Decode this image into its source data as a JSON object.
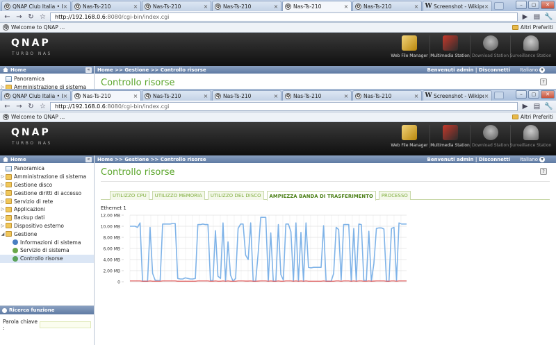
{
  "browser": {
    "tabs": [
      {
        "title": "QNAP Club Italia • Leg...",
        "favicon": "Q"
      },
      {
        "title": "Nas-Ts-210",
        "favicon": "Q"
      },
      {
        "title": "Nas-Ts-210",
        "favicon": "Q"
      },
      {
        "title": "Nas-Ts-210",
        "favicon": "Q"
      },
      {
        "title": "Nas-Ts-210",
        "favicon": "Q"
      },
      {
        "title": "Nas-Ts-210",
        "favicon": "Q"
      },
      {
        "title": "Screenshot - Wikipedia",
        "favicon": "W"
      }
    ],
    "back_active_tab": 4,
    "front_active_tab": 1,
    "url_host": "http://192.168.0.6",
    "url_path": ":8080/cgi-bin/index.cgi",
    "bookmark": "Welcome to QNAP ...",
    "other_bookmarks": "Altri Preferiti"
  },
  "qnap": {
    "logo": "QNAP",
    "subtitle": "TURBO NAS",
    "apps": [
      {
        "label": "Web File Manager",
        "icon": "web-file-manager-icon",
        "dim": false
      },
      {
        "label": "Multimedia Station",
        "icon": "multimedia-station-icon",
        "dim": false
      },
      {
        "label": "Download Station",
        "icon": "download-station-icon",
        "dim": true
      },
      {
        "label": "Surveillance Station",
        "icon": "surveillance-station-icon",
        "dim": true
      }
    ],
    "home_label": "Home",
    "breadcrumb": "Home >> Gestione >> Controllo risorse",
    "welcome": "Benvenuti admin | Disconnetti",
    "language": "Italiano",
    "page_title": "Controllo risorse"
  },
  "tree": [
    {
      "label": "Panoramica",
      "type": "page",
      "arrow": "",
      "level": 0
    },
    {
      "label": "Amministrazione di sistema",
      "type": "folder",
      "arrow": "▷",
      "level": 0
    },
    {
      "label": "Gestione disco",
      "type": "folder",
      "arrow": "▷",
      "level": 0
    },
    {
      "label": "Gestione diritti di accesso",
      "type": "folder",
      "arrow": "▷",
      "level": 0
    },
    {
      "label": "Servizio di rete",
      "type": "folder",
      "arrow": "▷",
      "level": 0
    },
    {
      "label": "Applicazioni",
      "type": "folder",
      "arrow": "▷",
      "level": 0
    },
    {
      "label": "Backup dati",
      "type": "folder",
      "arrow": "▷",
      "level": 0
    },
    {
      "label": "Dispositivo esterno",
      "type": "folder",
      "arrow": "▷",
      "level": 0
    },
    {
      "label": "Gestione",
      "type": "folder",
      "arrow": "◢",
      "level": 0
    },
    {
      "label": "Informazioni di sistema",
      "type": "info",
      "arrow": "",
      "level": 1
    },
    {
      "label": "Servizio di sistema",
      "type": "gear",
      "arrow": "",
      "level": 1
    },
    {
      "label": "Controllo risorse",
      "type": "mon",
      "arrow": "",
      "level": 1,
      "selected": true
    }
  ],
  "search": {
    "title": "Ricerca funzione",
    "label": "Parola chiave :",
    "value": ""
  },
  "resource_tabs": [
    {
      "label": "UTILIZZO CPU",
      "active": false
    },
    {
      "label": "UTILIZZO MEMORIA",
      "active": false
    },
    {
      "label": "UTILIZZO DEL DISCO",
      "active": false
    },
    {
      "label": "AMPIEZZA BANDA DI TRASFERIMENTO",
      "active": true
    },
    {
      "label": "PROCESSO",
      "active": false
    }
  ],
  "colors": {
    "rx_line": "#7fb3e8",
    "tx_line": "#e05050",
    "title_green": "#5aa52a"
  },
  "chart_data": {
    "type": "line",
    "title": "Ethernet 1",
    "ylim": [
      0,
      12
    ],
    "yticks": [
      0,
      2,
      4,
      6,
      8,
      10,
      12
    ],
    "ytick_labels": [
      "0",
      "2.00 MB",
      "4.00 MB",
      "6.00 MB",
      "8.00 MB",
      "10.00 MB",
      "12.00 MB"
    ],
    "series": [
      {
        "values": [
          10,
          10,
          10,
          9.8,
          10.6,
          0.1,
          0.1,
          0.1,
          9.8,
          1.5,
          0.3,
          0.2,
          0.2,
          10.4,
          10.4,
          10.4,
          10.4,
          10.5,
          10.5,
          0.6,
          0.5,
          0.5,
          0.7,
          0.6,
          0.5,
          0.5,
          0.6,
          10.3,
          10.3,
          10.4,
          10.3,
          10.3,
          0.2,
          0.2,
          9.2,
          1,
          0.6,
          10.6,
          0.1,
          7.2,
          1.2,
          0.1,
          0.6,
          9.6,
          10.4,
          10.4,
          4.8,
          4,
          10.6,
          0.1,
          0.1,
          5.2,
          11.6,
          11.6,
          11.6,
          0.1,
          8.8,
          0.1,
          0.1,
          10.3,
          1.3,
          0.3,
          10.4,
          10.4,
          9,
          0.1,
          10.6,
          0.1,
          8.9,
          0.1,
          10.6,
          2.6,
          2.5,
          2.6,
          2.6,
          2.6,
          2.6,
          10.1,
          0.1,
          0.1,
          0.1,
          1.5,
          9.8,
          9.4,
          0.3,
          10.3,
          10.3,
          10.3,
          0.1,
          9.6,
          0.1,
          10.4,
          10.3,
          0.2,
          0.2,
          9.1,
          0.1,
          3.3,
          9.6,
          9.7,
          9.7,
          9.5,
          0.1,
          0.1,
          9.6,
          9.8,
          0.2,
          10.6,
          10.4,
          10.4,
          10.4
        ]
      },
      {
        "values": [
          0.15,
          0.15,
          0.15,
          0.15,
          0.15,
          0.1,
          0.1,
          0.1,
          0.15,
          0.1,
          0.1,
          0.1,
          0.1,
          0.15,
          0.15,
          0.15,
          0.15,
          0.15,
          0.15,
          0.1,
          0.1,
          0.1,
          0.1,
          0.1,
          0.1,
          0.1,
          0.1,
          0.15,
          0.15,
          0.15,
          0.15,
          0.15,
          0.1,
          0.1,
          0.15,
          0.1,
          0.1,
          0.15,
          0.1,
          0.15,
          0.1,
          0.1,
          0.1,
          0.15,
          0.15,
          0.15,
          0.12,
          0.12,
          0.15,
          0.1,
          0.1,
          0.12,
          0.15,
          0.15,
          0.15,
          0.1,
          0.15,
          0.1,
          0.1,
          0.15,
          0.1,
          0.1,
          0.15,
          0.15,
          0.15,
          0.1,
          0.15,
          0.1,
          0.15,
          0.1,
          0.15,
          0.1,
          0.1,
          0.1,
          0.1,
          0.1,
          0.1,
          0.15,
          0.1,
          0.1,
          0.1,
          0.1,
          0.15,
          0.15,
          0.1,
          0.15,
          0.15,
          0.15,
          0.1,
          0.15,
          0.1,
          0.15,
          0.15,
          0.1,
          0.1,
          0.15,
          0.1,
          0.12,
          0.15,
          0.15,
          0.15,
          0.15,
          0.1,
          0.1,
          0.15,
          0.15,
          0.1,
          0.15,
          0.15,
          0.15,
          0.15
        ]
      }
    ]
  }
}
